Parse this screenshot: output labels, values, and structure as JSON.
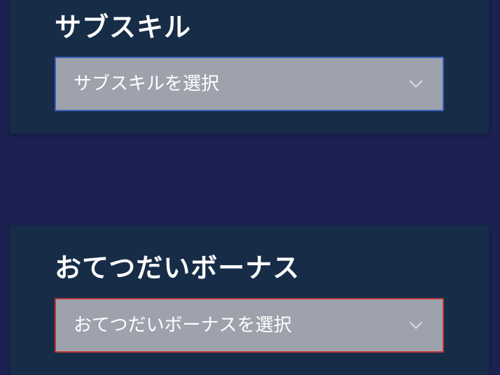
{
  "subskill": {
    "title": "サブスキル",
    "placeholder": "サブスキルを選択"
  },
  "help_bonus": {
    "title": "おてつだいボーナス",
    "placeholder": "おてつだいボーナスを選択"
  },
  "colors": {
    "background": "#1b2150",
    "card": "#172c47",
    "select_background": "#9ea2ad",
    "subskill_border": "#3a5fc0",
    "help_bonus_border": "#c0393b"
  },
  "icons": {
    "dropdown": "chevron-down-icon"
  }
}
